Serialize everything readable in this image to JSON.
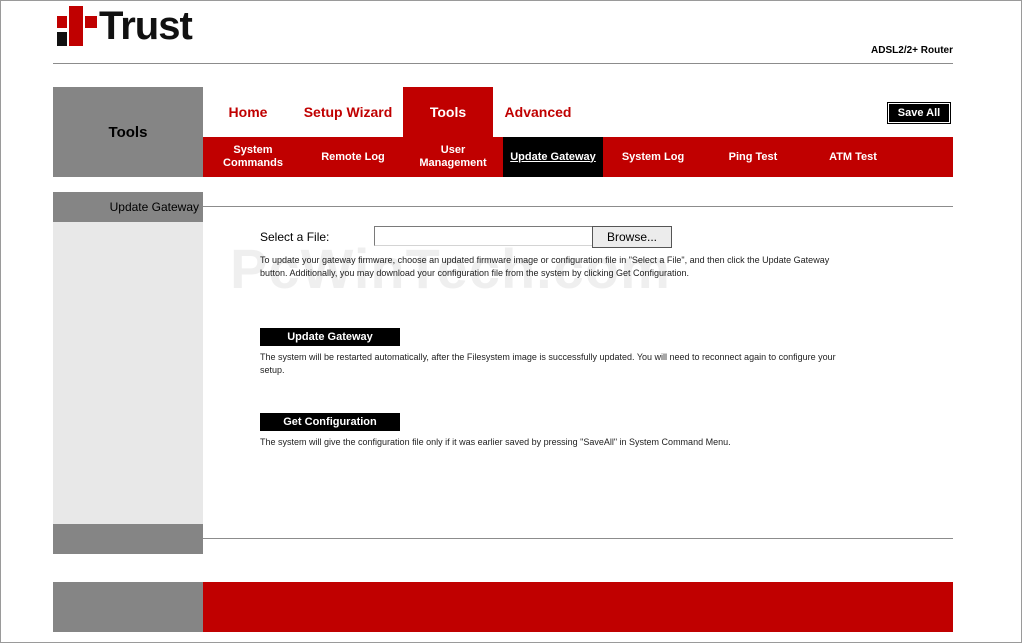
{
  "brand": {
    "name": "Trust",
    "product": "ADSL2/2+ Router",
    "accent_color": "#c00000"
  },
  "section_title": "Tools",
  "main_tabs": [
    {
      "label": "Home",
      "active": false
    },
    {
      "label": "Setup Wizard",
      "active": false
    },
    {
      "label": "Tools",
      "active": true
    },
    {
      "label": "Advanced",
      "active": false
    }
  ],
  "save_all_label": "Save All",
  "sub_tabs": [
    {
      "label": "System Commands",
      "active": false
    },
    {
      "label": "Remote Log",
      "active": false
    },
    {
      "label": "User Management",
      "active": false
    },
    {
      "label": "Update Gateway",
      "active": true
    },
    {
      "label": "System Log",
      "active": false
    },
    {
      "label": "Ping Test",
      "active": false
    },
    {
      "label": "ATM Test",
      "active": false
    }
  ],
  "side_label": "Update Gateway",
  "form": {
    "file_label": "Select a File:",
    "file_value": "",
    "browse_label": "Browse...",
    "file_help": "To update your gateway firmware, choose an updated firmware image or configuration file in \"Select a File\", and then click the Update Gateway button. Additionally, you may download your configuration file from the system by clicking Get Configuration.",
    "update_label": "Update Gateway",
    "update_help": "The system will be restarted automatically, after the Filesystem image is successfully updated. You will need to reconnect again to configure your setup.",
    "get_config_label": "Get Configuration",
    "get_config_help": "The system will give the configuration file only if it was earlier saved by pressing \"SaveAll\" in System Command Menu."
  },
  "watermark": "PcWinTech.com"
}
